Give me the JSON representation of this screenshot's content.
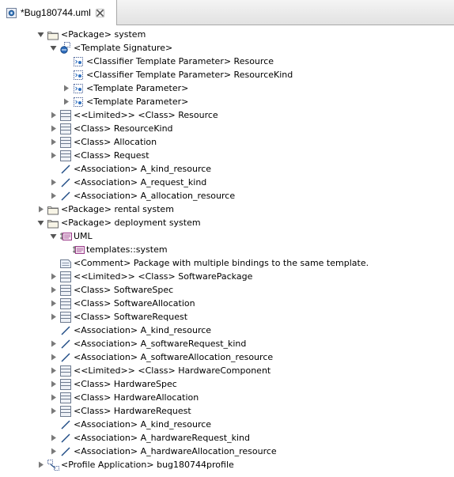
{
  "editor": {
    "tab_title": "*Bug180744.uml",
    "tab_icon": "uml-model-file-icon",
    "close_icon": "close-icon"
  },
  "tree": [
    {
      "label": "<Package> system",
      "icon": "package-icon",
      "twisty": "expanded"
    },
    {
      "label": "<Template Signature>",
      "icon": "template-signature-icon",
      "twisty": "expanded"
    },
    {
      "label": "<Classifier Template Parameter> Resource",
      "icon": "template-parameter-icon",
      "twisty": "none"
    },
    {
      "label": "<Classifier Template Parameter> ResourceKind",
      "icon": "template-parameter-icon",
      "twisty": "none"
    },
    {
      "label": "<Template Parameter>",
      "icon": "template-parameter-icon",
      "twisty": "collapsed"
    },
    {
      "label": "<Template Parameter>",
      "icon": "template-parameter-icon",
      "twisty": "collapsed"
    },
    {
      "label": "<<Limited>> <Class> Resource",
      "icon": "class-icon",
      "twisty": "collapsed"
    },
    {
      "label": "<Class> ResourceKind",
      "icon": "class-icon",
      "twisty": "collapsed"
    },
    {
      "label": "<Class> Allocation",
      "icon": "class-icon",
      "twisty": "collapsed"
    },
    {
      "label": "<Class> Request",
      "icon": "class-icon",
      "twisty": "collapsed"
    },
    {
      "label": "<Association> A_kind_resource",
      "icon": "association-icon",
      "twisty": "none"
    },
    {
      "label": "<Association> A_request_kind",
      "icon": "association-icon",
      "twisty": "collapsed"
    },
    {
      "label": "<Association> A_allocation_resource",
      "icon": "association-icon",
      "twisty": "collapsed"
    },
    {
      "label": "<Package> rental system",
      "icon": "package-icon",
      "twisty": "collapsed"
    },
    {
      "label": "<Package> deployment system",
      "icon": "package-icon",
      "twisty": "expanded"
    },
    {
      "label": "UML",
      "icon": "template-binding-icon",
      "twisty": "expanded"
    },
    {
      "label": "templates::system",
      "icon": "template-binding-icon",
      "twisty": "none"
    },
    {
      "label": "<Comment> Package with multiple bindings to the same template.",
      "icon": "comment-icon",
      "twisty": "none"
    },
    {
      "label": "<<Limited>> <Class> SoftwarePackage",
      "icon": "class-icon",
      "twisty": "collapsed"
    },
    {
      "label": "<Class> SoftwareSpec",
      "icon": "class-icon",
      "twisty": "collapsed"
    },
    {
      "label": "<Class> SoftwareAllocation",
      "icon": "class-icon",
      "twisty": "collapsed"
    },
    {
      "label": "<Class> SoftwareRequest",
      "icon": "class-icon",
      "twisty": "collapsed"
    },
    {
      "label": "<Association> A_kind_resource",
      "icon": "association-icon",
      "twisty": "none"
    },
    {
      "label": "<Association> A_softwareRequest_kind",
      "icon": "association-icon",
      "twisty": "collapsed"
    },
    {
      "label": "<Association> A_softwareAllocation_resource",
      "icon": "association-icon",
      "twisty": "collapsed"
    },
    {
      "label": "<<Limited>> <Class> HardwareComponent",
      "icon": "class-icon",
      "twisty": "collapsed"
    },
    {
      "label": "<Class> HardwareSpec",
      "icon": "class-icon",
      "twisty": "collapsed"
    },
    {
      "label": "<Class> HardwareAllocation",
      "icon": "class-icon",
      "twisty": "collapsed"
    },
    {
      "label": "<Class> HardwareRequest",
      "icon": "class-icon",
      "twisty": "collapsed"
    },
    {
      "label": "<Association> A_kind_resource",
      "icon": "association-icon",
      "twisty": "none"
    },
    {
      "label": "<Association> A_hardwareRequest_kind",
      "icon": "association-icon",
      "twisty": "collapsed"
    },
    {
      "label": "<Association> A_hardwareAllocation_resource",
      "icon": "association-icon",
      "twisty": "collapsed"
    },
    {
      "label": "<Profile Application> bug180744profile",
      "icon": "profile-application-icon",
      "twisty": "collapsed"
    }
  ]
}
